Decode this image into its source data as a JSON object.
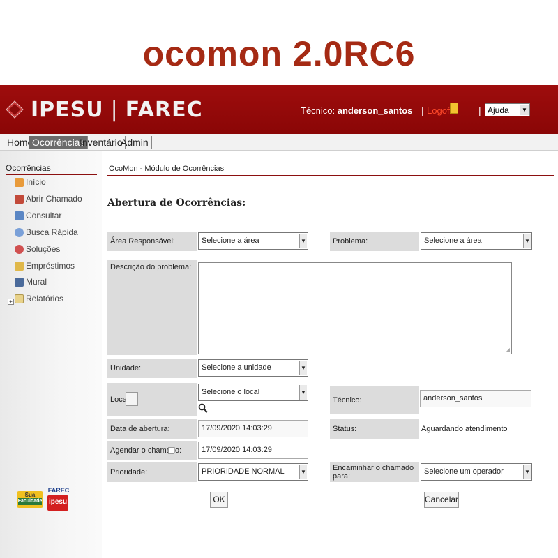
{
  "banner_title": "ocomon 2.0RC6",
  "header": {
    "logo_left": "IPESU",
    "logo_sep": "|",
    "logo_right": "FAREC",
    "tech_label": "Técnico:",
    "tech_name": "anderson_santos",
    "logoff": "Logoff",
    "help_select": "Ajuda"
  },
  "nav": {
    "items": [
      "Home",
      "Ocorrências",
      "Inventário",
      "Admin"
    ],
    "active": "Ocorrências"
  },
  "sidebar": {
    "title": "Ocorrências",
    "items": [
      {
        "label": "Início",
        "icon": "home-icon"
      },
      {
        "label": "Abrir Chamado",
        "icon": "open-ticket-icon"
      },
      {
        "label": "Consultar",
        "icon": "query-icon"
      },
      {
        "label": "Busca Rápida",
        "icon": "search-icon"
      },
      {
        "label": "Soluções",
        "icon": "solutions-icon"
      },
      {
        "label": "Empréstimos",
        "icon": "loans-icon"
      },
      {
        "label": "Mural",
        "icon": "board-icon"
      },
      {
        "label": "Relatórios",
        "icon": "folder-icon"
      }
    ],
    "logos": {
      "a_line1": "Sua",
      "a_line2": "Faculdade",
      "b_line1": "FAREC",
      "b_line2": "ipesu"
    }
  },
  "main": {
    "breadcrumb": "OcoMon - Módulo de Ocorrências",
    "form_title": "Abertura de Ocorrências:",
    "fields": {
      "area_label": "Área Responsável:",
      "area_value": "Selecione a área",
      "problema_label": "Problema:",
      "problema_value": "Selecione a área",
      "descricao_label": "Descrição do problema:",
      "descricao_value": "",
      "unidade_label": "Unidade:",
      "unidade_value": "Selecione a unidade",
      "local_label": "Local:",
      "local_value": "Selecione o local",
      "tecnico_label": "Técnico:",
      "tecnico_value": "anderson_santos",
      "data_label": "Data de abertura:",
      "data_value": "17/09/2020 14:03:29",
      "status_label": "Status:",
      "status_value": "Aguardando atendimento",
      "agendar_label": "Agendar o chamado:",
      "agendar_value": "17/09/2020 14:03:29",
      "prioridade_label": "Prioridade:",
      "prioridade_value": "PRIORIDADE NORMAL",
      "encaminhar_label": "Encaminhar o chamado para:",
      "encaminhar_value": "Selecione um operador"
    },
    "ok_button": "OK",
    "cancel_button": "Cancelar"
  },
  "colors": {
    "brand_red": "#9e0d0d",
    "banner_text": "#a52a14",
    "label_bg": "#dcdcdc"
  }
}
